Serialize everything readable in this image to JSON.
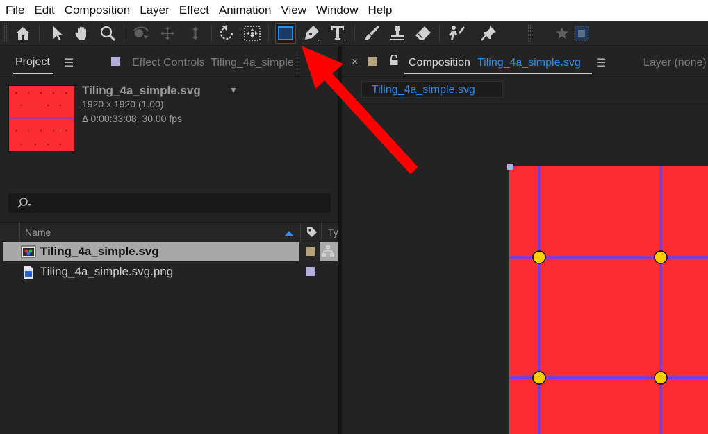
{
  "menu": [
    "File",
    "Edit",
    "Composition",
    "Layer",
    "Effect",
    "Animation",
    "View",
    "Window",
    "Help"
  ],
  "toolbar": {
    "tools": [
      "home-icon",
      "selection-arrow-icon",
      "hand-icon",
      "zoom-icon",
      "orbit-icon",
      "pan-icon",
      "dolly-icon",
      "rotate-icon",
      "pan-behind-icon",
      "rectangle-icon",
      "pen-icon",
      "type-icon",
      "brush-icon",
      "clone-stamp-icon",
      "eraser-icon",
      "roto-brush-icon",
      "puppet-pin-icon",
      "star-icon",
      "snapping-icon"
    ],
    "active_tool": "rectangle-icon",
    "accent": "#2d8ceb"
  },
  "project_panel": {
    "tab_label": "Project",
    "effect_controls_label": "Effect Controls",
    "effect_controls_target": "Tiling_4a_simple",
    "asset": {
      "title": "Tiling_4a_simple.svg",
      "dimensions": "1920 x 1920 (1.00)",
      "duration": "Δ 0:00:33:08, 30.00 fps"
    },
    "search_placeholder": "",
    "columns": {
      "name": "Name",
      "type": "Ty"
    },
    "items": [
      {
        "name": "Tiling_4a_simple.svg",
        "selected": true,
        "label_color": "#b5a07f"
      },
      {
        "name": "Tiling_4a_simple.svg.png",
        "selected": false,
        "label_color": "#b3aed9"
      }
    ]
  },
  "composition_panel": {
    "tab_prefix": "Composition",
    "comp_name": "Tiling_4a_simple.svg",
    "layer_tab": "Layer  (none)",
    "breadcrumb": "Tiling_4a_simple.svg",
    "canvas_color": "#fc2d32",
    "line_color": "#6a3ff2",
    "dot_color": "#ffcc00"
  },
  "annotation": {
    "arrow_color": "#ff0000"
  }
}
